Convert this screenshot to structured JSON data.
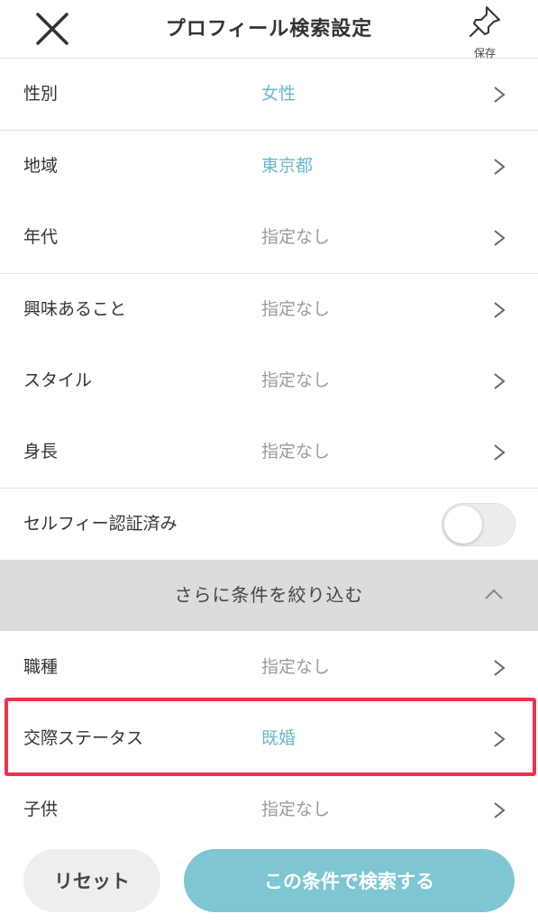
{
  "header": {
    "title": "プロフィール検索設定",
    "close_icon": "close-icon",
    "save_icon": "pin-icon",
    "save_label": "保存"
  },
  "rows": [
    {
      "label": "性別",
      "value": "女性",
      "is_set": true
    },
    {
      "label": "地域",
      "value": "東京都",
      "is_set": true
    },
    {
      "label": "年代",
      "value": "指定なし",
      "is_set": false
    },
    {
      "label": "興味あること",
      "value": "指定なし",
      "is_set": false
    },
    {
      "label": "スタイル",
      "value": "指定なし",
      "is_set": false
    },
    {
      "label": "身長",
      "value": "指定なし",
      "is_set": false
    }
  ],
  "selfie": {
    "label": "セルフィー認証済み",
    "enabled": false
  },
  "narrow": {
    "label": "さらに条件を絞り込む",
    "expanded": true
  },
  "more_rows": [
    {
      "label": "職種",
      "value": "指定なし",
      "is_set": false
    },
    {
      "label": "交際ステータス",
      "value": "既婚",
      "is_set": true
    },
    {
      "label": "子供",
      "value": "指定なし",
      "is_set": false
    }
  ],
  "footer": {
    "reset_label": "リセット",
    "search_label": "この条件で検索する"
  },
  "colors": {
    "accent": "#66b9c7",
    "search_button": "#7ec7d2",
    "highlight": "#e8344f"
  }
}
